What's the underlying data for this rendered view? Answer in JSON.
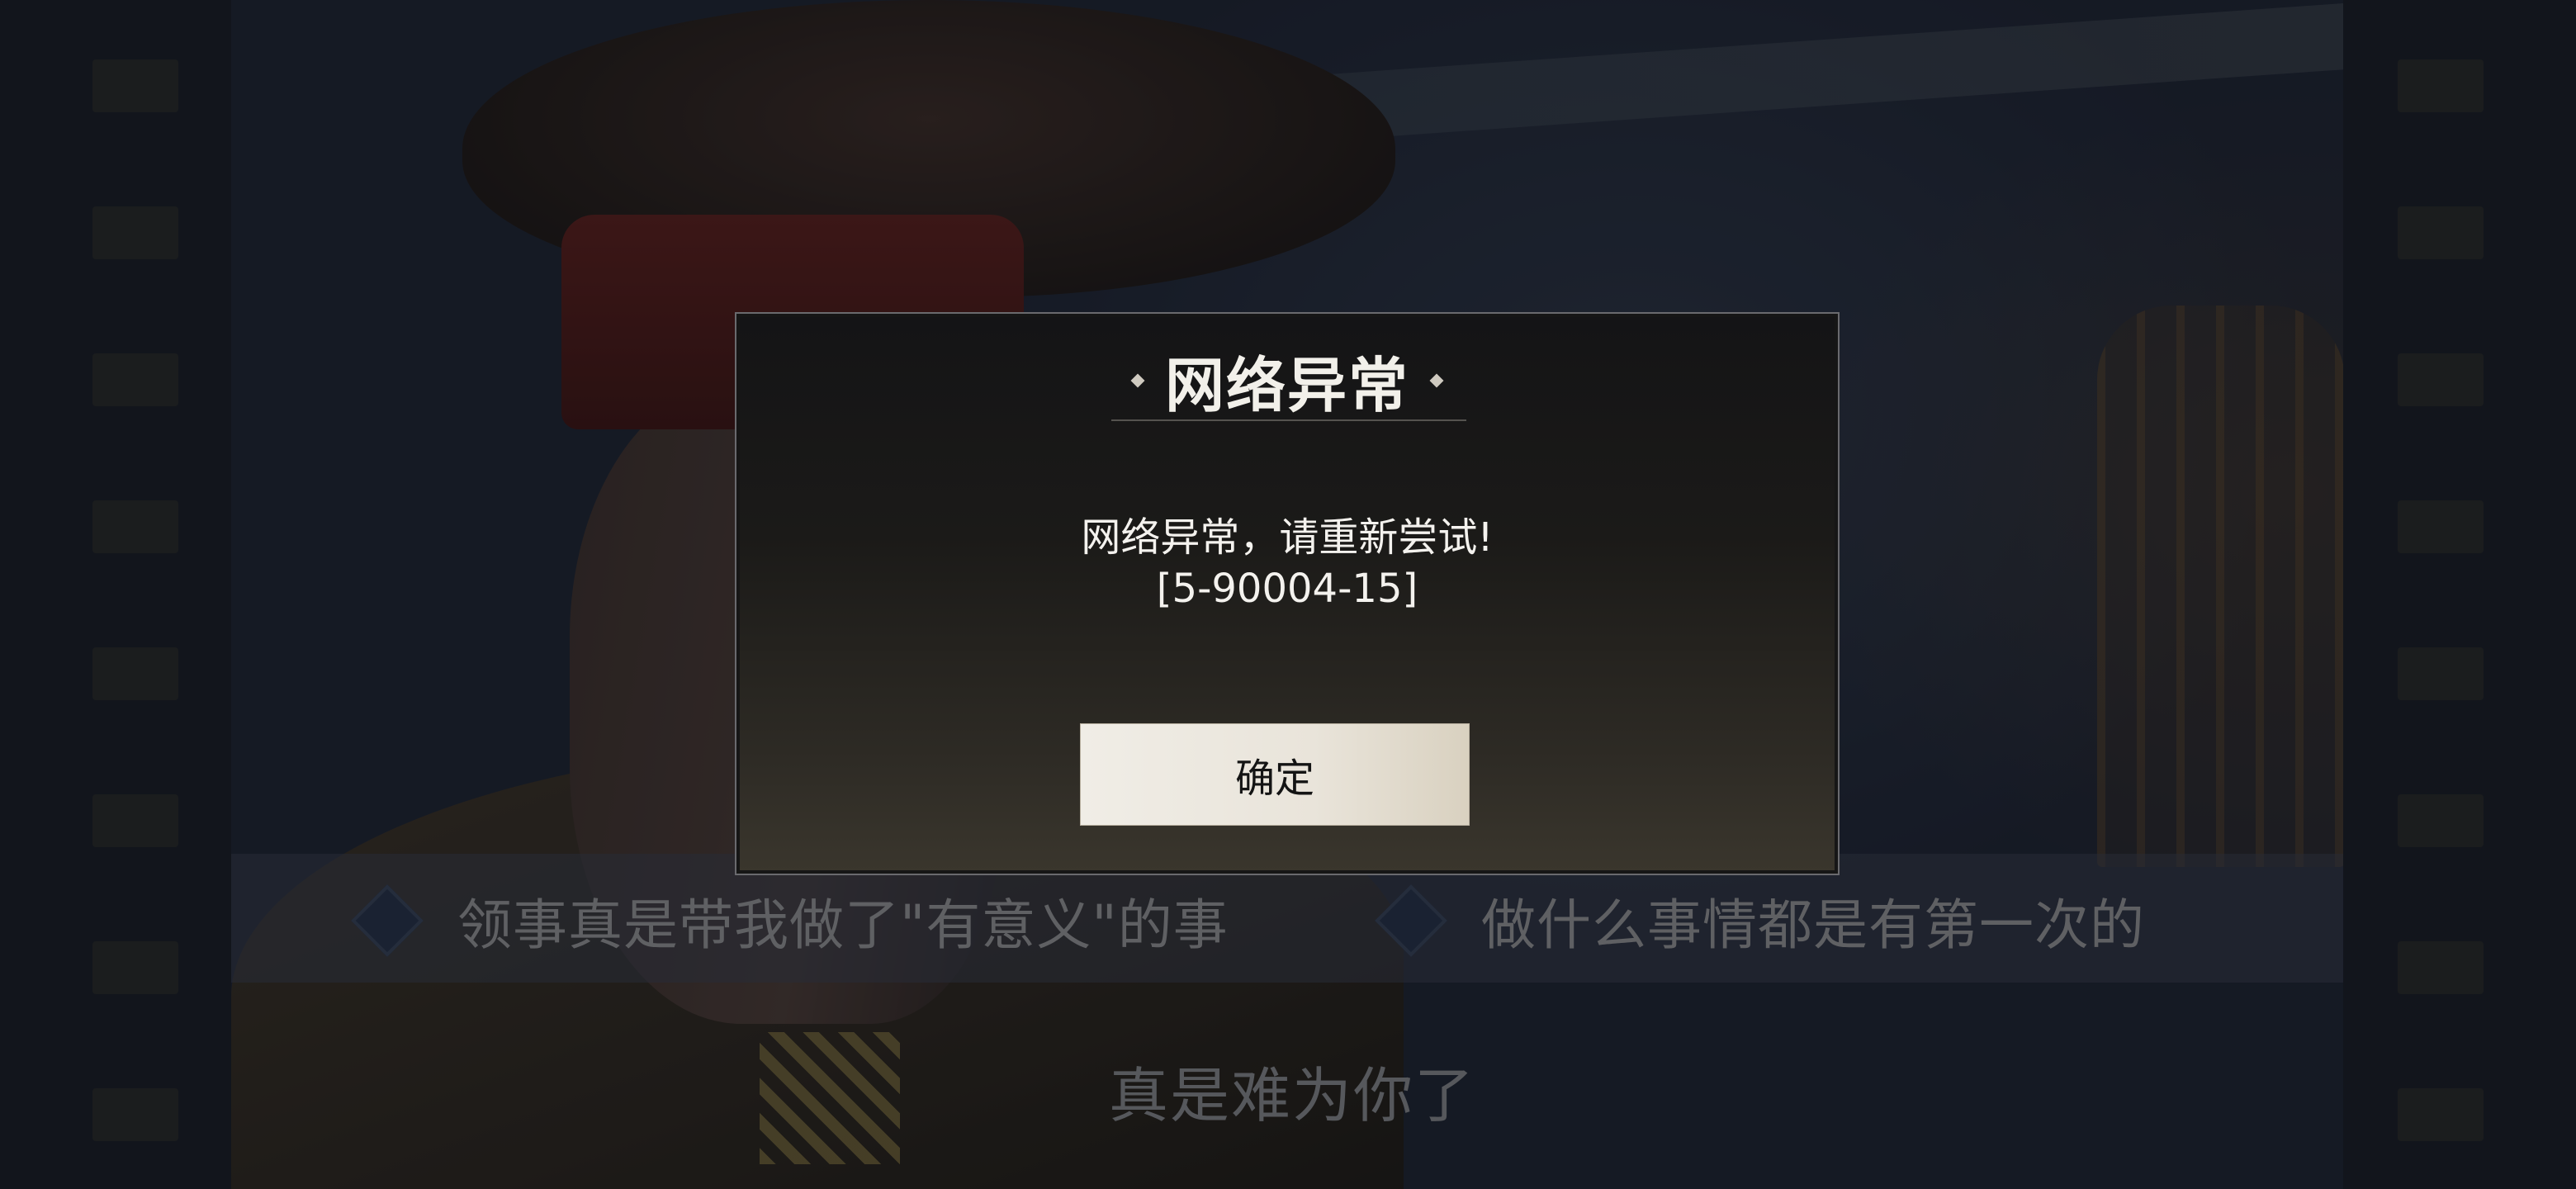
{
  "dialog": {
    "title": "网络异常",
    "message_line1": "网络异常，请重新尝试!",
    "message_line2": "[5-90004-15]",
    "confirm_label": "确定"
  },
  "choices": [
    {
      "label": "领事真是带我做了\"有意义\"的事"
    },
    {
      "label": "做什么事情都是有第一次的"
    }
  ],
  "subtitle": "真是难为你了",
  "colors": {
    "dialog_background": "#1b1a18",
    "dialog_border": "#6a6a6e",
    "button_background": "#ece8df",
    "choice_text": "#5f6063",
    "cap_band": "#5a1d1a"
  }
}
